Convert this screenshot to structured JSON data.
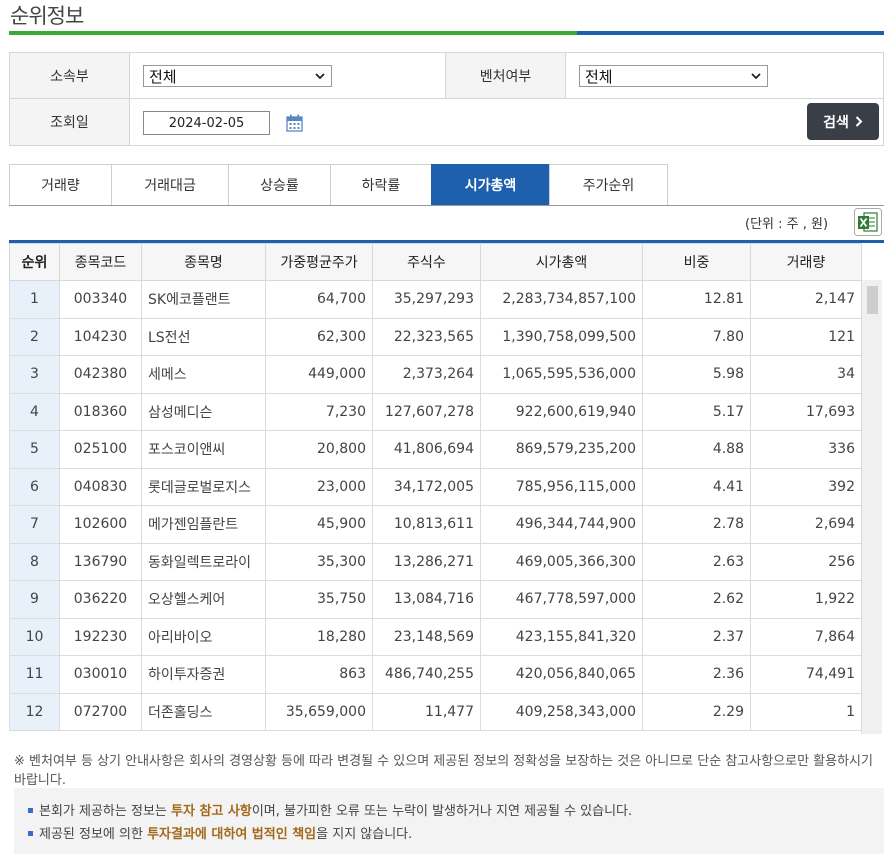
{
  "page_title": "순위정보",
  "search": {
    "affiliation_label": "소속부",
    "affiliation_value": "전체",
    "venture_label": "벤처여부",
    "venture_value": "전체",
    "date_label": "조회일",
    "date_value": "2024-02-05",
    "search_button": "검색"
  },
  "tabs": [
    {
      "label": "거래량"
    },
    {
      "label": "거래대금"
    },
    {
      "label": "상승률"
    },
    {
      "label": "하락률"
    },
    {
      "label": "시가총액",
      "active": true
    },
    {
      "label": "주가순위"
    }
  ],
  "unit_text": "(단위 : 주 , 원)",
  "table": {
    "headers": [
      "순위",
      "종목코드",
      "종목명",
      "가중평균주가",
      "주식수",
      "시가총액",
      "비중",
      "거래량"
    ],
    "rows": [
      [
        "1",
        "003340",
        "SK에코플랜트",
        "64,700",
        "35,297,293",
        "2,283,734,857,100",
        "12.81",
        "2,147"
      ],
      [
        "2",
        "104230",
        "LS전선",
        "62,300",
        "22,323,565",
        "1,390,758,099,500",
        "7.80",
        "121"
      ],
      [
        "3",
        "042380",
        "세메스",
        "449,000",
        "2,373,264",
        "1,065,595,536,000",
        "5.98",
        "34"
      ],
      [
        "4",
        "018360",
        "삼성메디슨",
        "7,230",
        "127,607,278",
        "922,600,619,940",
        "5.17",
        "17,693"
      ],
      [
        "5",
        "025100",
        "포스코이앤씨",
        "20,800",
        "41,806,694",
        "869,579,235,200",
        "4.88",
        "336"
      ],
      [
        "6",
        "040830",
        "롯데글로벌로지스",
        "23,000",
        "34,172,005",
        "785,956,115,000",
        "4.41",
        "392"
      ],
      [
        "7",
        "102600",
        "메가젠임플란트",
        "45,900",
        "10,813,611",
        "496,344,744,900",
        "2.78",
        "2,694"
      ],
      [
        "8",
        "136790",
        "동화일렉트로라이",
        "35,300",
        "13,286,271",
        "469,005,366,300",
        "2.63",
        "256"
      ],
      [
        "9",
        "036220",
        "오상헬스케어",
        "35,750",
        "13,084,716",
        "467,778,597,000",
        "2.62",
        "1,922"
      ],
      [
        "10",
        "192230",
        "아리바이오",
        "18,280",
        "23,148,569",
        "423,155,841,320",
        "2.37",
        "7,864"
      ],
      [
        "11",
        "030010",
        "하이투자증권",
        "863",
        "486,740,255",
        "420,056,840,065",
        "2.36",
        "74,491"
      ],
      [
        "12",
        "072700",
        "더존홀딩스",
        "35,659,000",
        "11,477",
        "409,258,343,000",
        "2.29",
        "1"
      ]
    ]
  },
  "notice": "※ 벤처여부 등 상기 안내사항은 회사의 경영상황 등에 따라 변경될 수 있으며 제공된 정보의 정확성을 보장하는 것은 아니므로 단순 참고사항으로만 활용하시기 바랍니다.",
  "info": {
    "line1_pre": "본회가 제공하는 정보는 ",
    "line1_hl": "투자 참고 사항",
    "line1_post": "이며, 불가피한 오류 또는 누락이 발생하거나 지연 제공될 수 있습니다.",
    "line2_pre": "제공된 정보에 의한 ",
    "line2_hl": "투자결과에 대하여 법적인 책임",
    "line2_post": "을 지지 않습니다."
  },
  "colors": {
    "accent_blue": "#1e5fae",
    "accent_green": "#3aaa35",
    "button_dark": "#3a3f47"
  }
}
